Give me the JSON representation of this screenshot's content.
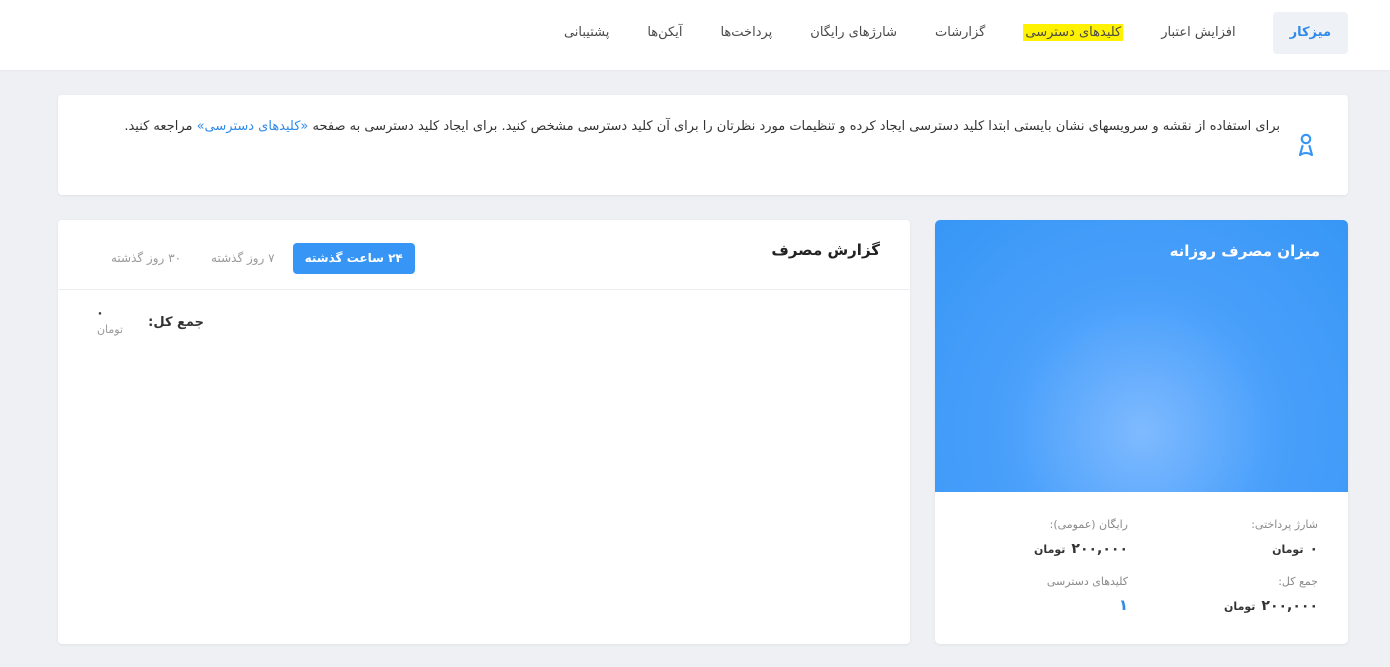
{
  "nav": {
    "items": [
      {
        "label": "میزکار",
        "active": true
      },
      {
        "label": "افزایش اعتبار"
      },
      {
        "label": "کلیدهای دسترسی",
        "highlighted": true
      },
      {
        "label": "گزارشات"
      },
      {
        "label": "شارژهای رایگان"
      },
      {
        "label": "پرداخت‌ها"
      },
      {
        "label": "آیکن‌ها"
      },
      {
        "label": "پشتیبانی"
      }
    ]
  },
  "info": {
    "text": "برای استفاده از نقشه و سرویسهای نشان بایستی ابتدا کلید دسترسی ایجاد کرده و تنظیمات مورد نظرتان را برای آن کلید دسترسی مشخص کنید. برای ایجاد کلید دسترسی به صفحه ",
    "link": "«کلیدهای دسترسی»",
    "suffix": " مراجعه کنید."
  },
  "daily": {
    "title": "میزان مصرف روزانه",
    "paid_label": "شارژ پرداختی:",
    "paid_value": "۰",
    "free_label": "رایگان (عمومی):",
    "free_value": "۲۰۰,۰۰۰",
    "total_label": "جمع کل:",
    "total_value": "۲۰۰,۰۰۰",
    "keys_label": "کلیدهای دسترسی",
    "keys_value": "۱",
    "unit": "تومان"
  },
  "usage": {
    "title": "گزارش مصرف",
    "tabs": [
      {
        "label": "۲۴ ساعت گذشته",
        "active": true
      },
      {
        "label": "۷ روز گذشته"
      },
      {
        "label": "۳۰ روز گذشته"
      }
    ],
    "total_label": "جمع کل:",
    "total_value": "۰",
    "unit": "تومان"
  },
  "colors": {
    "accent": "#3796f5",
    "highlight": "#fff200",
    "background": "#eef0f4"
  }
}
